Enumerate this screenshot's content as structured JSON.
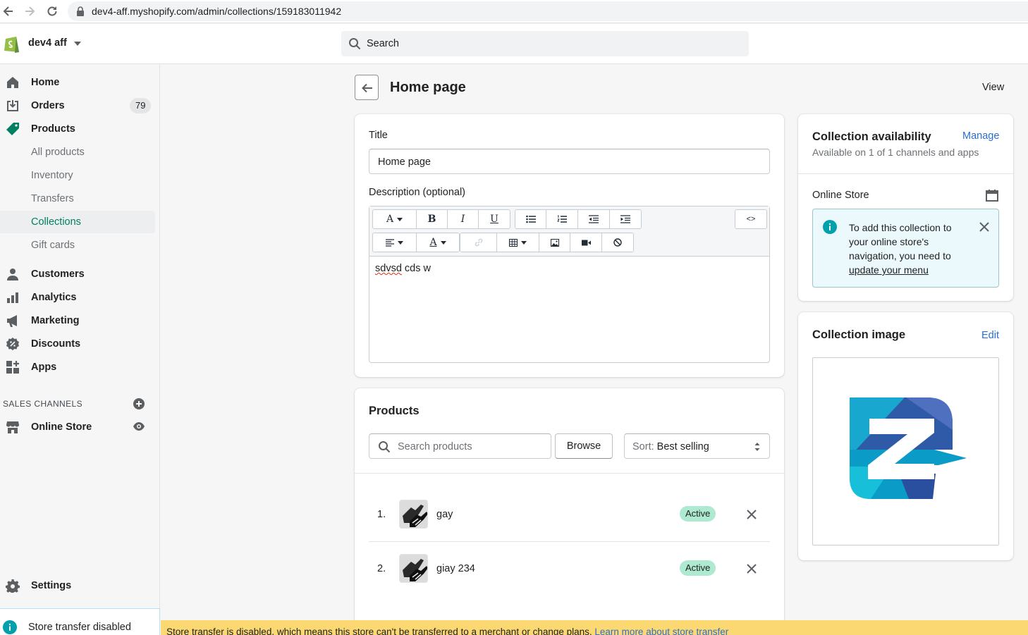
{
  "browser": {
    "url": "dev4-aff.myshopify.com/admin/collections/159183011942"
  },
  "topbar": {
    "store_name": "dev4 aff",
    "search_placeholder": "Search"
  },
  "sidebar": {
    "items": [
      {
        "label": "Home",
        "icon": "home-icon"
      },
      {
        "label": "Orders",
        "icon": "orders-icon",
        "badge": "79"
      },
      {
        "label": "Products",
        "icon": "products-icon"
      },
      {
        "label": "Customers",
        "icon": "customers-icon"
      },
      {
        "label": "Analytics",
        "icon": "analytics-icon"
      },
      {
        "label": "Marketing",
        "icon": "marketing-icon"
      },
      {
        "label": "Discounts",
        "icon": "discounts-icon"
      },
      {
        "label": "Apps",
        "icon": "apps-icon"
      }
    ],
    "product_subitems": [
      "All products",
      "Inventory",
      "Transfers",
      "Collections",
      "Gift cards"
    ],
    "active_subitem": "Collections",
    "sales_channels_heading": "SALES CHANNELS",
    "online_store": "Online Store",
    "settings": "Settings",
    "transfer_notice": "Store transfer disabled"
  },
  "page": {
    "title": "Home page",
    "view_link": "View"
  },
  "details": {
    "title_label": "Title",
    "title_value": "Home page",
    "description_label": "Description (optional)",
    "description_misspelled": "sdvsd",
    "description_rest": " cds w",
    "html_toggle": "<>"
  },
  "products": {
    "heading": "Products",
    "search_placeholder": "Search products",
    "browse": "Browse",
    "sort_prefix": "Sort: ",
    "sort_value": "Best selling",
    "rows": [
      {
        "num": "1.",
        "name": "gay",
        "status": "Active"
      },
      {
        "num": "2.",
        "name": "giay 234",
        "status": "Active"
      }
    ]
  },
  "availability": {
    "heading": "Collection availability",
    "manage": "Manage",
    "subtitle": "Available on 1 of 1 channels and apps",
    "channel": "Online Store",
    "banner_text": "To add this collection to your online store's navigation, you need to",
    "banner_link": "update your menu"
  },
  "image_card": {
    "heading": "Collection image",
    "edit": "Edit"
  },
  "bottom_banner": {
    "text": "Store transfer is disabled, which means this store can't be transferred to a merchant or change plans.",
    "link": "Learn more about store transfer"
  },
  "colors": {
    "accent": "#008060",
    "link": "#2c6ecb",
    "badge_active": "#aee9d1",
    "warning": "#fcd872",
    "info_bg": "#ebf9fc"
  }
}
